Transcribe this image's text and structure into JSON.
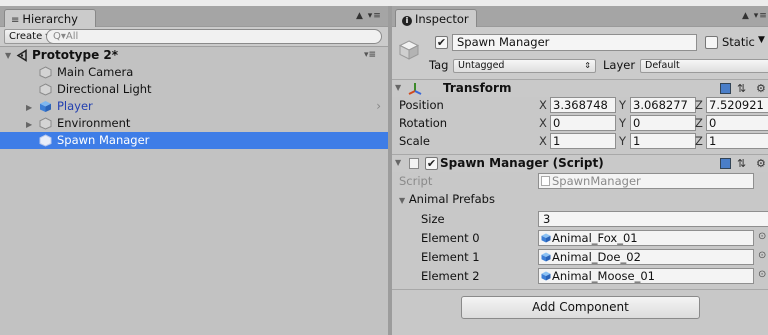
{
  "hierarchy": {
    "tab_label": "Hierarchy",
    "lock_menu": "▲ ▾≡",
    "create_label": "Create ▾",
    "search_placeholder": "Q▾All",
    "scene": {
      "name": "Prototype 2*",
      "menu": "▾≡"
    },
    "items": [
      {
        "label": "Main Camera"
      },
      {
        "label": "Directional Light"
      },
      {
        "label": "Player"
      },
      {
        "label": "Environment"
      },
      {
        "label": "Spawn Manager"
      }
    ]
  },
  "inspector": {
    "tab_label": "Inspector",
    "tab_icon": "i",
    "lock_menu": "▲ ▾≡",
    "object": {
      "name": "Spawn Manager",
      "active": true,
      "static_label": "Static",
      "tag_label": "Tag",
      "tag_value": "Untagged",
      "layer_label": "Layer",
      "layer_value": "Default"
    },
    "transform": {
      "title": "Transform",
      "rows": [
        {
          "label": "Position",
          "x": "3.368748",
          "y": "3.068277",
          "z": "7.520921"
        },
        {
          "label": "Rotation",
          "x": "0",
          "y": "0",
          "z": "0"
        },
        {
          "label": "Scale",
          "x": "1",
          "y": "1",
          "z": "1"
        }
      ],
      "axis_x": "X",
      "axis_y": "Y",
      "axis_z": "Z"
    },
    "script_component": {
      "title": "Spawn Manager (Script)",
      "script_label": "Script",
      "script_value": "SpawnManager",
      "array_label": "Animal Prefabs",
      "size_label": "Size",
      "size_value": "3",
      "elements": [
        {
          "label": "Element 0",
          "value": "Animal_Fox_01"
        },
        {
          "label": "Element 1",
          "value": "Animal_Doe_02"
        },
        {
          "label": "Element 2",
          "value": "Animal_Moose_01"
        }
      ]
    },
    "add_component_label": "Add Component"
  },
  "colors": {
    "selection": "#3e7de7",
    "player_text": "#2340b0",
    "cube_blue": "#4a8fe0"
  }
}
